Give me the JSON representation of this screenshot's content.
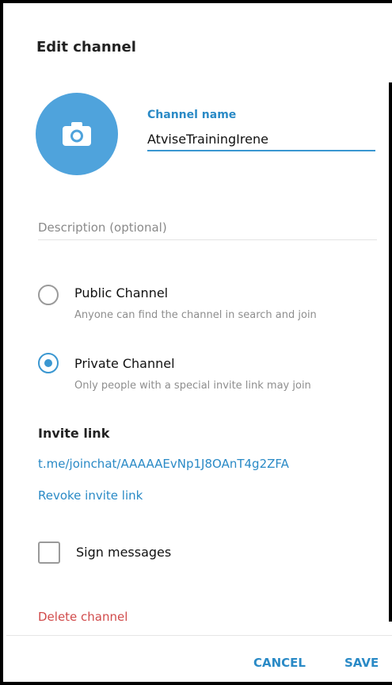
{
  "dialog": {
    "title": "Edit channel"
  },
  "avatar": {
    "icon": "camera-icon",
    "color": "#4fa3dc"
  },
  "channel_name": {
    "label": "Channel name",
    "value": "AtviseTrainingIrene"
  },
  "description": {
    "placeholder": "Description (optional)",
    "value": ""
  },
  "channel_type": {
    "options": [
      {
        "title": "Public Channel",
        "description": "Anyone can find the channel in search and join",
        "selected": false
      },
      {
        "title": "Private Channel",
        "description": "Only people with a special invite link may join",
        "selected": true
      }
    ]
  },
  "invite": {
    "header": "Invite link",
    "link": "t.me/joinchat/AAAAAEvNp1J8OAnT4g2ZFA",
    "revoke_label": "Revoke invite link"
  },
  "sign_messages": {
    "label": "Sign messages",
    "checked": false
  },
  "delete_label": "Delete channel",
  "footer": {
    "cancel_label": "CANCEL",
    "save_label": "SAVE"
  },
  "colors": {
    "accent": "#3a97d1",
    "link": "#2a8ac6",
    "danger": "#d14b4b"
  }
}
